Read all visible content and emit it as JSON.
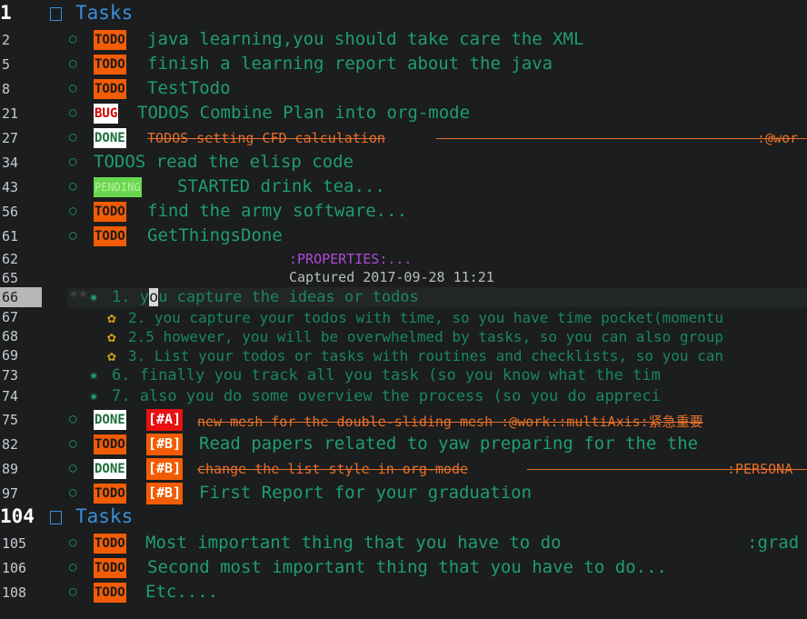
{
  "lines": {
    "l1": {
      "num": "1",
      "title": "Tasks"
    },
    "l2": {
      "num": "2",
      "kw": "TODO",
      "text": "java learning,you should take care the XML"
    },
    "l5": {
      "num": "5",
      "kw": "TODO",
      "text": "finish a learning report about the java"
    },
    "l8": {
      "num": "8",
      "kw": "TODO",
      "text": "TestTodo"
    },
    "l21": {
      "num": "21",
      "kw": "BUG",
      "text": "TODOS Combine Plan into org-mode"
    },
    "l27": {
      "num": "27",
      "kw": "DONE",
      "text": "TODOS setting CFD calculation",
      "tag": ":@wor"
    },
    "l34": {
      "num": "34",
      "text": "TODOS read the elisp code"
    },
    "l43": {
      "num": "43",
      "kw": "PENDING",
      "text": "STARTED drink tea..."
    },
    "l56": {
      "num": "56",
      "kw": "TODO",
      "text": "find the army software..."
    },
    "l61": {
      "num": "61",
      "kw": "TODO",
      "text": "GetThingsDone"
    },
    "l62": {
      "num": "62",
      "text": ":PROPERTIES:..."
    },
    "l65": {
      "num": "65",
      "text": "Captured 2017-09-28 11:21"
    },
    "l66": {
      "num": "66",
      "pre": "1. y",
      "cursor": "o",
      "post": "u capture the ideas or todos"
    },
    "l67": {
      "num": "67",
      "text": "2. you capture your todos with time, so you have time pocket(momentu"
    },
    "l68": {
      "num": "68",
      "text": "2.5 however, you will be overwhelmed by tasks, so you can also group"
    },
    "l69": {
      "num": "69",
      "text": "3. List your todos or tasks with routines and checklists, so you can"
    },
    "l73": {
      "num": "73",
      "text": "6. finally you track all you task (so you know what the tim"
    },
    "l74": {
      "num": "74",
      "text": "7. also you do some overview the process (so you do appreci"
    },
    "l75": {
      "num": "75",
      "kw": "DONE",
      "prio": "[#A]",
      "text": "new mesh for the double-sliding mesh :@work::multiAxis:紧急重要"
    },
    "l82": {
      "num": "82",
      "kw": "TODO",
      "prio": "[#B]",
      "text": "Read papers related to yaw preparing for the the"
    },
    "l89": {
      "num": "89",
      "kw": "DONE",
      "prio": "[#B]",
      "text": "change the list style in org-mode",
      "tag": ":PERSONA"
    },
    "l97": {
      "num": "97",
      "kw": "TODO",
      "prio": "[#B]",
      "text": "First Report for your graduation"
    },
    "l104": {
      "num": "104",
      "title": "Tasks"
    },
    "l105": {
      "num": "105",
      "kw": "TODO",
      "text": "Most important thing that you have to do",
      "tag": ":grad"
    },
    "l106": {
      "num": "106",
      "kw": "TODO",
      "text": "Second most important thing that you have to do..."
    },
    "l108": {
      "num": "108",
      "kw": "TODO",
      "text": "Etc...."
    }
  },
  "symbols": {
    "bullet": "○",
    "star": "✷",
    "flower": "✿",
    "lead": "**"
  },
  "colors": {
    "todo": "#f25c05",
    "done_bg": "#ffffff",
    "prio_a": "#e81010",
    "text": "#1f9e6e",
    "heading": "#3b8fd8"
  }
}
